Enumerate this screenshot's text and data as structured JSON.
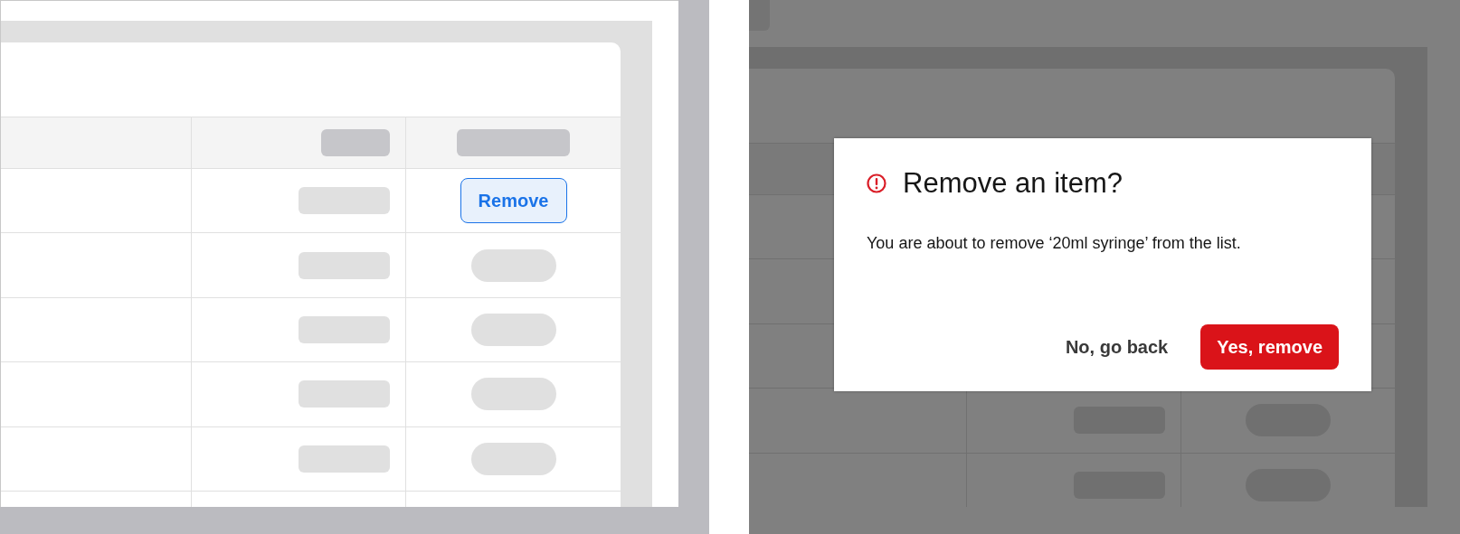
{
  "table": {
    "rows": [
      {
        "kind": "button",
        "label": "Remove"
      },
      {
        "kind": "skeleton"
      },
      {
        "kind": "skeleton"
      },
      {
        "kind": "skeleton"
      },
      {
        "kind": "skeleton"
      }
    ]
  },
  "dialog": {
    "title": "Remove an item?",
    "message": "You are about to remove ‘20ml syringe’ from the list.",
    "buttons": [
      {
        "label": "No, go back",
        "kind": "secondary"
      },
      {
        "label": "Yes, remove",
        "kind": "danger"
      }
    ]
  }
}
